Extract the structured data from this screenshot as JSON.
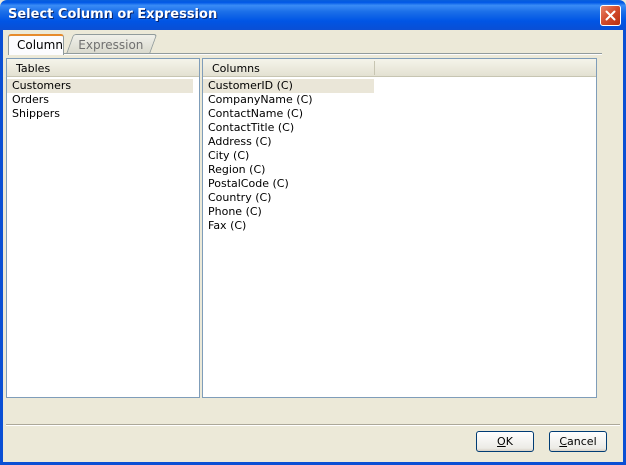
{
  "window": {
    "title": "Select Column or Expression"
  },
  "tabs": [
    {
      "label": "Column",
      "active": true
    },
    {
      "label": "Expression",
      "active": false
    }
  ],
  "tables": {
    "header": "Tables",
    "items": [
      "Customers",
      "Orders",
      "Shippers"
    ],
    "selected": "Customers"
  },
  "columns": {
    "header": "Columns",
    "items": [
      "CustomerID (C)",
      "CompanyName (C)",
      "ContactName (C)",
      "ContactTitle (C)",
      "Address (C)",
      "City (C)",
      "Region (C)",
      "PostalCode (C)",
      "Country (C)",
      "Phone (C)",
      "Fax (C)"
    ],
    "selected": "CustomerID (C)"
  },
  "buttons": {
    "ok": {
      "label": "OK",
      "mnemonic": "O"
    },
    "cancel": {
      "label": "Cancel",
      "mnemonic": "C"
    }
  },
  "icons": {
    "close": "close-icon"
  },
  "colors": {
    "titlebar": "#0055e5",
    "close": "#d24a2a",
    "selection": "#eae6d8"
  }
}
